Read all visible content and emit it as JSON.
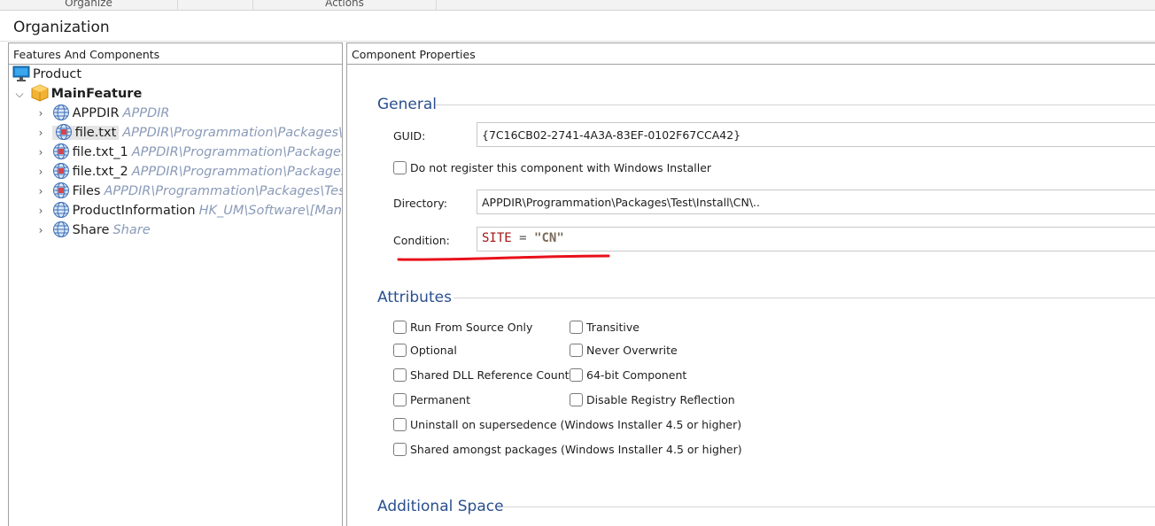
{
  "ribbon": {
    "groups": [
      "Organize",
      "Actions"
    ]
  },
  "organization": {
    "title": "Organization"
  },
  "left_pane": {
    "header": "Features And Components",
    "tree": {
      "product": {
        "label": "Product"
      },
      "main_feature": {
        "label": "MainFeature"
      },
      "components": [
        {
          "label": "APPDIR",
          "path": "APPDIR"
        },
        {
          "label": "file.txt",
          "path": "APPDIR\\Programmation\\Packages\\Test\\Install\\CN\\.."
        },
        {
          "label": "file.txt_1",
          "path": "APPDIR\\Programmation\\Packages\\Test\\Install"
        },
        {
          "label": "file.txt_2",
          "path": "APPDIR\\Programmation\\Packages\\Test\\Install"
        },
        {
          "label": "Files",
          "path": "APPDIR\\Programmation\\Packages\\Test\\Install"
        },
        {
          "label": "ProductInformation",
          "path": "HK_UM\\Software\\[Manufacturer]"
        },
        {
          "label": "Share",
          "path": "Share"
        }
      ]
    }
  },
  "right_pane": {
    "header": "Component Properties",
    "general": {
      "title": "General",
      "guid_label": "GUID:",
      "guid_value": "{7C16CB02-2741-4A3A-83EF-0102F67CCA42}",
      "no_register_label": "Do not register this component with Windows Installer",
      "directory_label": "Directory:",
      "directory_value": "APPDIR\\Programmation\\Packages\\Test\\Install\\CN\\..",
      "condition_label": "Condition:",
      "condition": {
        "identifier": "SITE",
        "operator": "=",
        "value": "\"CN\""
      }
    },
    "attributes": {
      "title": "Attributes",
      "run_from_source": "Run From Source Only",
      "transitive": "Transitive",
      "optional": "Optional",
      "never_overwrite": "Never Overwrite",
      "shared_dll": "Shared DLL Reference Count",
      "bit64": "64-bit Component",
      "permanent": "Permanent",
      "disable_registry": "Disable Registry Reflection",
      "uninstall_supersedence": "Uninstall on supersedence (Windows Installer 4.5 or higher)",
      "shared_packages": "Shared amongst packages (Windows Installer 4.5 or higher)"
    },
    "additional_space": {
      "title": "Additional Space"
    }
  },
  "colors": {
    "section_title": "#2a4f8f",
    "path_text": "#8a9ab8",
    "annotation_underline": "#e8101a",
    "condition_identifier": "#a31515"
  }
}
